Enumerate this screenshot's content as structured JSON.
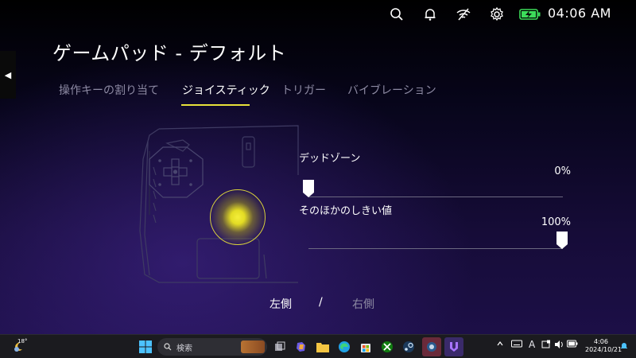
{
  "status_bar": {
    "clock": "04:06 AM",
    "icons": [
      "search-icon",
      "bell-icon",
      "wifi-off-icon",
      "settings-icon",
      "battery-charging-icon"
    ],
    "battery_color": "#3ddc5a"
  },
  "page": {
    "back_glyph": "◀",
    "title": "ゲームパッド - デフォルト"
  },
  "tabs": [
    {
      "label": "操作キーの割り当て",
      "active": false
    },
    {
      "label": "ジョイスティック",
      "active": true
    },
    {
      "label": "トリガー",
      "active": false
    },
    {
      "label": "バイブレーション",
      "active": false
    }
  ],
  "accent_color": "#e8e23a",
  "sliders": {
    "deadzone": {
      "label": "デッドゾーン",
      "value_text": "0%",
      "value": 0
    },
    "threshold": {
      "label": "そのほかのしきい値",
      "value_text": "100%",
      "value": 100
    }
  },
  "side_toggle": {
    "left": "左側",
    "separator": "/",
    "right": "右側",
    "selected": "left"
  },
  "taskbar": {
    "weather_temp": "18°",
    "search_placeholder": "検索",
    "tray_ime": "A",
    "tray_date_time": "4:06",
    "tray_date": "2024/10/21",
    "apps": [
      "start-icon",
      "search-icon",
      "file-explorer-icon",
      "copilot-icon",
      "folder-icon",
      "edge-icon",
      "store-icon",
      "xbox-icon",
      "steam-icon",
      "game-app-icon",
      "legion-app-icon"
    ]
  }
}
